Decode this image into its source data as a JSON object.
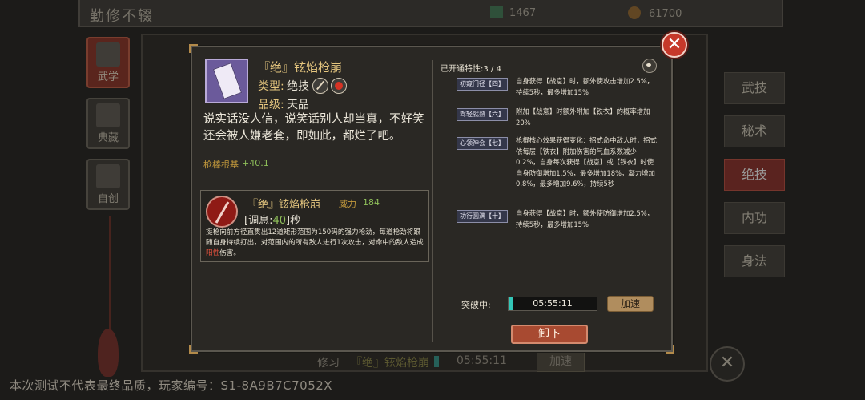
{
  "background": {
    "title": "勤修不辍",
    "currency_jade": "1467",
    "currency_coin": "61700",
    "left_nav": [
      {
        "label": "武学",
        "active": true
      },
      {
        "label": "典藏",
        "active": false
      },
      {
        "label": "自创",
        "active": false
      }
    ],
    "right_tabs": [
      {
        "label": "武技",
        "active": false
      },
      {
        "label": "秘术",
        "active": false
      },
      {
        "label": "绝技",
        "active": true
      },
      {
        "label": "内功",
        "active": false
      },
      {
        "label": "身法",
        "active": false
      }
    ],
    "bottom_bar": {
      "status": "修习",
      "skill": "『绝』铉焰枪崩",
      "timer": "05:55:11",
      "button": "加速"
    },
    "footer_note": "本次测试不代表最终品质，玩家编号：S1-8A9B7C7052X"
  },
  "dialog": {
    "skill": {
      "name": "『绝』铉焰枪崩",
      "type_label": "类型:",
      "type": "绝技",
      "grade_label": "品级:",
      "grade": "天品",
      "quote": "说实话没人信，说笑话别人却当真，不好笑还会被人嫌老套，即如此，都烂了吧。",
      "stat_label": "枪棒根基",
      "stat_value": "+40.1"
    },
    "move": {
      "name": "『绝』铉焰枪崩",
      "power_label": "威力",
      "power": "184",
      "cooldown_prefix": "[调息:",
      "cooldown_value": "40",
      "cooldown_suffix": "]秒",
      "desc_main": "挺枪向前方径直贯出12道矩形范围为150码的强力枪劲，每道枪劲将跟随自身持续打出，对范围内的所有敌人进行1次攻击，对命中的敌人造成",
      "desc_element": "阳性",
      "desc_end": "伤害。"
    },
    "traits_title": "已开通特性:3 / 4",
    "traits": [
      {
        "tag": "初窥门径【四】",
        "text": "自身获得【战意】时，额外使攻击增加2.5%，持续5秒，最多增加15%"
      },
      {
        "tag": "驾轻就熟【六】",
        "text": "附加【战意】时额外附加【铁衣】的概率增加20%"
      },
      {
        "tag": "心领神会【七】",
        "text": "枪棍核心效果获得变化：招式命中敌人时，招式依每层【铁衣】附加伤害的气血系数减少0.2%，自身每次获得【战意】或【铁衣】时使自身防御增加1.5%，最多增加18%，凝力增加0.8%，最多增加9.6%，持续5秒"
      },
      {
        "tag": "功行圆满【十】",
        "text": "自身获得【战意】时，额外使防御增加2.5%，持续5秒，最多增加15%"
      }
    ],
    "breakthrough_label": "突破中:",
    "breakthrough_timer": "05:55:11",
    "breakthrough_progress": 0.05,
    "speedup_label": "加速",
    "unequip_label": "卸下"
  }
}
